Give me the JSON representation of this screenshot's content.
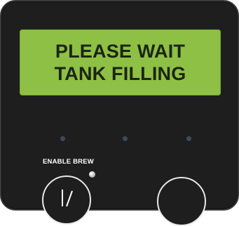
{
  "display": {
    "line1": "PLEASE WAIT",
    "line2": "TANK FILLING",
    "backlight_color": "#8dc044"
  },
  "controls": {
    "enable_brew_label": "ENABLE BREW",
    "brew_button_icon": "brew-lever-icon"
  },
  "indicators": {
    "led_color": "#3b4a5a",
    "status_light_color": "#d9d9d9"
  },
  "colors": {
    "panel": "#1e1e1f",
    "panel_border": "#3a3a3a"
  }
}
